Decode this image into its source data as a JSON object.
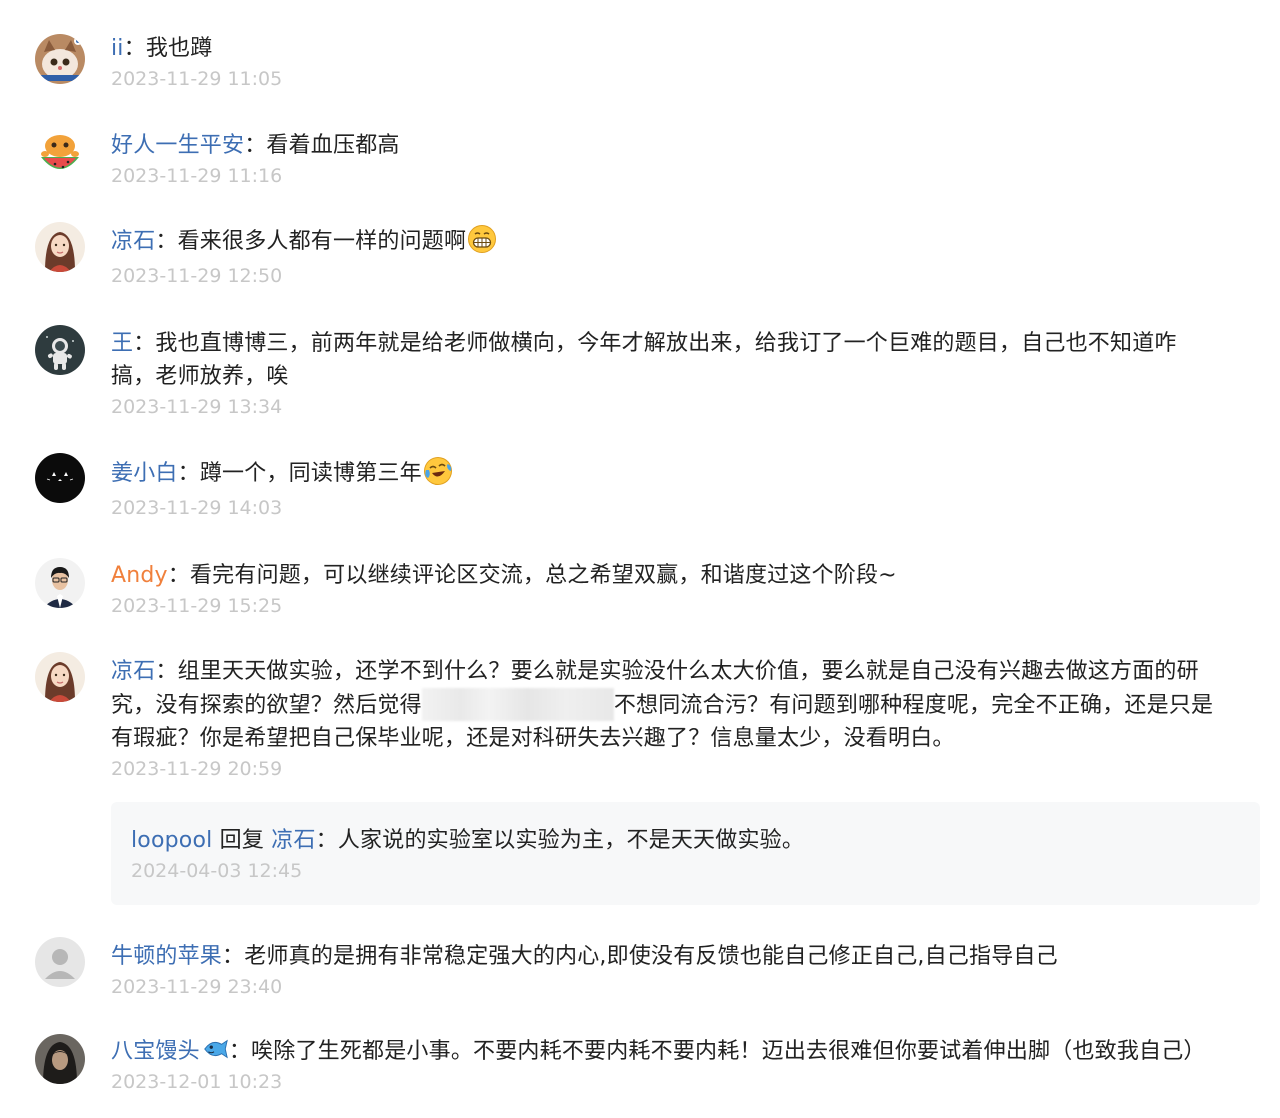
{
  "comments": [
    {
      "author": "ii",
      "colon": "：",
      "segments": [
        "我也蹲"
      ],
      "time": "2023-11-29 11:05",
      "avatar": "cat-avatar"
    },
    {
      "author": "好人一生平安",
      "colon": "：",
      "segments": [
        "看着血压都高"
      ],
      "time": "2023-11-29 11:16",
      "avatar": "watermelon-face-avatar"
    },
    {
      "author": "凉石",
      "colon": "：",
      "segments": [
        "看来很多人都有一样的问题啊"
      ],
      "emoji": "grinning-emoji",
      "time": "2023-11-29 12:50",
      "avatar": "girl-portrait-avatar"
    },
    {
      "author": "王",
      "colon": "：",
      "segments": [
        "我也直博博三，前两年就是给老师做横向，今年才解放出来，给我订了一个巨难的题目，自己也不知道咋",
        "搞，老师放养，唉"
      ],
      "time": "2023-11-29 13:34",
      "avatar": "astronaut-avatar"
    },
    {
      "author": "姜小白",
      "colon": "：",
      "segments": [
        "蹲一个，同读博第三年"
      ],
      "emoji": "crying-laughing-emoji",
      "time": "2023-11-29 14:03",
      "avatar": "black-cat-avatar"
    },
    {
      "author": "Andy",
      "colon": "：",
      "segments": [
        "看完有问题，可以继续评论区交流，总之希望双赢，和谐度过这个阶段~"
      ],
      "time": "2023-11-29 15:25",
      "avatar": "man-portrait-avatar"
    },
    {
      "author": "凉石",
      "colon": "：",
      "segments": [
        "组里天天做实验，还学不到什么？要么就是实验没什么太大价值，要么就是自己没有兴趣去做这方面的研",
        "究，没有探索的欲望？然后觉得",
        "不想同流合污？有问题到哪种程度呢，完全不正确，还是只是",
        "有瑕疵？你是希望把自己保毕业呢，还是对科研失去兴趣了？信息量太少，没看明白。"
      ],
      "time": "2023-11-29 20:59",
      "avatar": "girl-portrait-avatar",
      "reply": {
        "author": "loopool",
        "verb": "回复",
        "target": "凉石",
        "colon": "：",
        "text": "人家说的实验室以实验为主，不是天天做实验。",
        "time": "2024-04-03 12:45"
      }
    },
    {
      "author": "牛顿的苹果",
      "colon": "：",
      "segments": [
        "老师真的是拥有非常稳定强大的内心,即使没有反馈也能自己修正自己,自己指导自己"
      ],
      "time": "2023-11-29 23:40",
      "avatar": "default-user-avatar"
    },
    {
      "author": "八宝馒头",
      "badge": "blue-fish-icon",
      "colon": "：",
      "segments": [
        "唉除了生死都是小事。不要内耗不要内耗不要内耗！迈出去很难但你要试着伸出脚（也致我自己）"
      ],
      "time": "2023-12-01 10:23",
      "avatar": "hooded-figure-avatar"
    }
  ]
}
